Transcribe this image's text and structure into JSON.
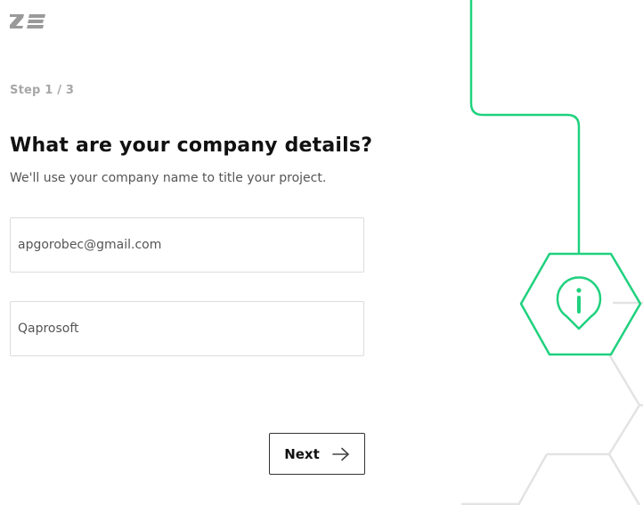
{
  "header": {
    "logo_icon": "ze-logo-icon"
  },
  "form": {
    "step_label": "Step 1 / 3",
    "title": "What are your company details?",
    "subtitle": "We'll use your company name to title your project.",
    "email_value": "apgorobec@gmail.com",
    "company_value": "Qaprosoft"
  },
  "actions": {
    "next_label": "Next",
    "next_icon": "arrow-right-icon"
  },
  "decoration": {
    "icon": "info-pin-icon",
    "accent_color": "#1fd17e",
    "line_color": "#e3e3e3"
  }
}
